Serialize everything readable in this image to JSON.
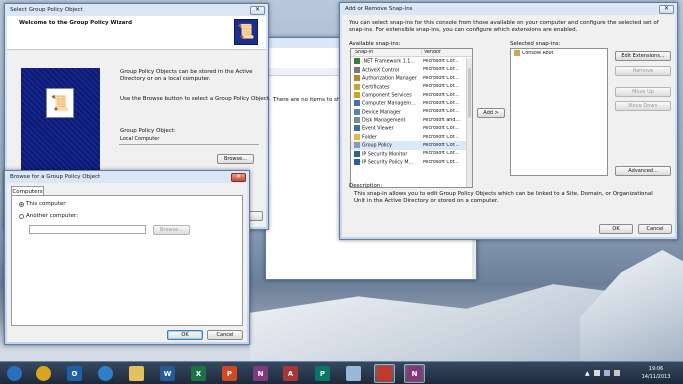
{
  "gpo_wizard": {
    "title": "Select Group Policy Object",
    "heading": "Welcome to the Group Policy Wizard",
    "desc1": "Group Policy Objects can be stored in the Active Directory or on a local computer.",
    "desc2": "Use the Browse button to select a Group Policy Object.",
    "gpo_label": "Group Policy Object:",
    "gpo_value": "Local Computer",
    "browse_label": "Browse..."
  },
  "mmc_bg": {
    "message": "There are no items to sho"
  },
  "snapins": {
    "title": "Add or Remove Snap-ins",
    "intro": "You can select snap-ins for this console from those available on your computer and configure the selected set of snap-ins. For extensible snap-ins, you can configure which extensions are enabled.",
    "available_label": "Available snap-ins:",
    "selected_label": "Selected snap-ins:",
    "col_snapin": "Snap-in",
    "col_vendor": "Vendor",
    "items": [
      {
        "name": ".NET Framework 1.1...",
        "vendor": "Microsoft Cor...",
        "color": "#3a7d3a"
      },
      {
        "name": "ActiveX Control",
        "vendor": "Microsoft Cor...",
        "color": "#7a7a7a"
      },
      {
        "name": "Authorization Manager",
        "vendor": "Microsoft Cor...",
        "color": "#b08a2e"
      },
      {
        "name": "Certificates",
        "vendor": "Microsoft Cor...",
        "color": "#c9a23a"
      },
      {
        "name": "Component Services",
        "vendor": "Microsoft Cor...",
        "color": "#d4a020"
      },
      {
        "name": "Computer Managem...",
        "vendor": "Microsoft Cor...",
        "color": "#4a6fa5"
      },
      {
        "name": "Device Manager",
        "vendor": "Microsoft Cor...",
        "color": "#5a7fb0"
      },
      {
        "name": "Disk Management",
        "vendor": "Microsoft and...",
        "color": "#7a8a9a"
      },
      {
        "name": "Event Viewer",
        "vendor": "Microsoft Cor...",
        "color": "#3f6fa0"
      },
      {
        "name": "Folder",
        "vendor": "Microsoft Cor...",
        "color": "#e0b84a"
      },
      {
        "name": "Group Policy",
        "vendor": "Microsoft Cor...",
        "color": "#8a9ab0"
      },
      {
        "name": "IP Security Monitor",
        "vendor": "Microsoft Cor...",
        "color": "#2f5f8f"
      },
      {
        "name": "IP Security Policy M...",
        "vendor": "Microsoft Cor...",
        "color": "#2f5f8f"
      }
    ],
    "selected_items": [
      "Console Root"
    ],
    "add_label": "Add >",
    "edit_ext": "Edit Extensions...",
    "remove": "Remove",
    "move_up": "Move Up",
    "move_down": "Move Down",
    "advanced": "Advanced...",
    "desc_label": "Description:",
    "desc_text": "This snap-in allows you to edit Group Policy Objects which can be linked to a Site, Domain, or Organizational Unit in the Active Directory or stored on a computer.",
    "ok": "OK",
    "cancel": "Cancel"
  },
  "browse": {
    "title": "Browse for a Group Policy Object",
    "tab": "Computers",
    "opt_this": "This computer",
    "opt_another": "Another computer:",
    "browse_label": "Browse...",
    "ok": "OK",
    "cancel": "Cancel"
  },
  "taskbar": {
    "time": "19:06",
    "date": "14/11/2013",
    "apps": [
      {
        "id": "start",
        "glyph": "",
        "color": "#2a6fc0"
      },
      {
        "id": "chrome",
        "glyph": "",
        "color": "#d9a520"
      },
      {
        "id": "outlook",
        "glyph": "O",
        "color": "#1f5fa8"
      },
      {
        "id": "media",
        "glyph": "",
        "color": "#2e7fc8"
      },
      {
        "id": "explorer",
        "glyph": "",
        "color": "#e3c060"
      },
      {
        "id": "word",
        "glyph": "W",
        "color": "#2b5797"
      },
      {
        "id": "excel",
        "glyph": "X",
        "color": "#1e7145"
      },
      {
        "id": "powerpoint",
        "glyph": "P",
        "color": "#d24726"
      },
      {
        "id": "onenote",
        "glyph": "N",
        "color": "#80397b"
      },
      {
        "id": "access",
        "glyph": "A",
        "color": "#a4373a"
      },
      {
        "id": "publisher",
        "glyph": "P",
        "color": "#077568"
      },
      {
        "id": "notepad",
        "glyph": "",
        "color": "#9ab8d8"
      },
      {
        "id": "toolbox",
        "glyph": "",
        "color": "#c0392b"
      },
      {
        "id": "onenote2",
        "glyph": "N",
        "color": "#80397b"
      }
    ]
  }
}
